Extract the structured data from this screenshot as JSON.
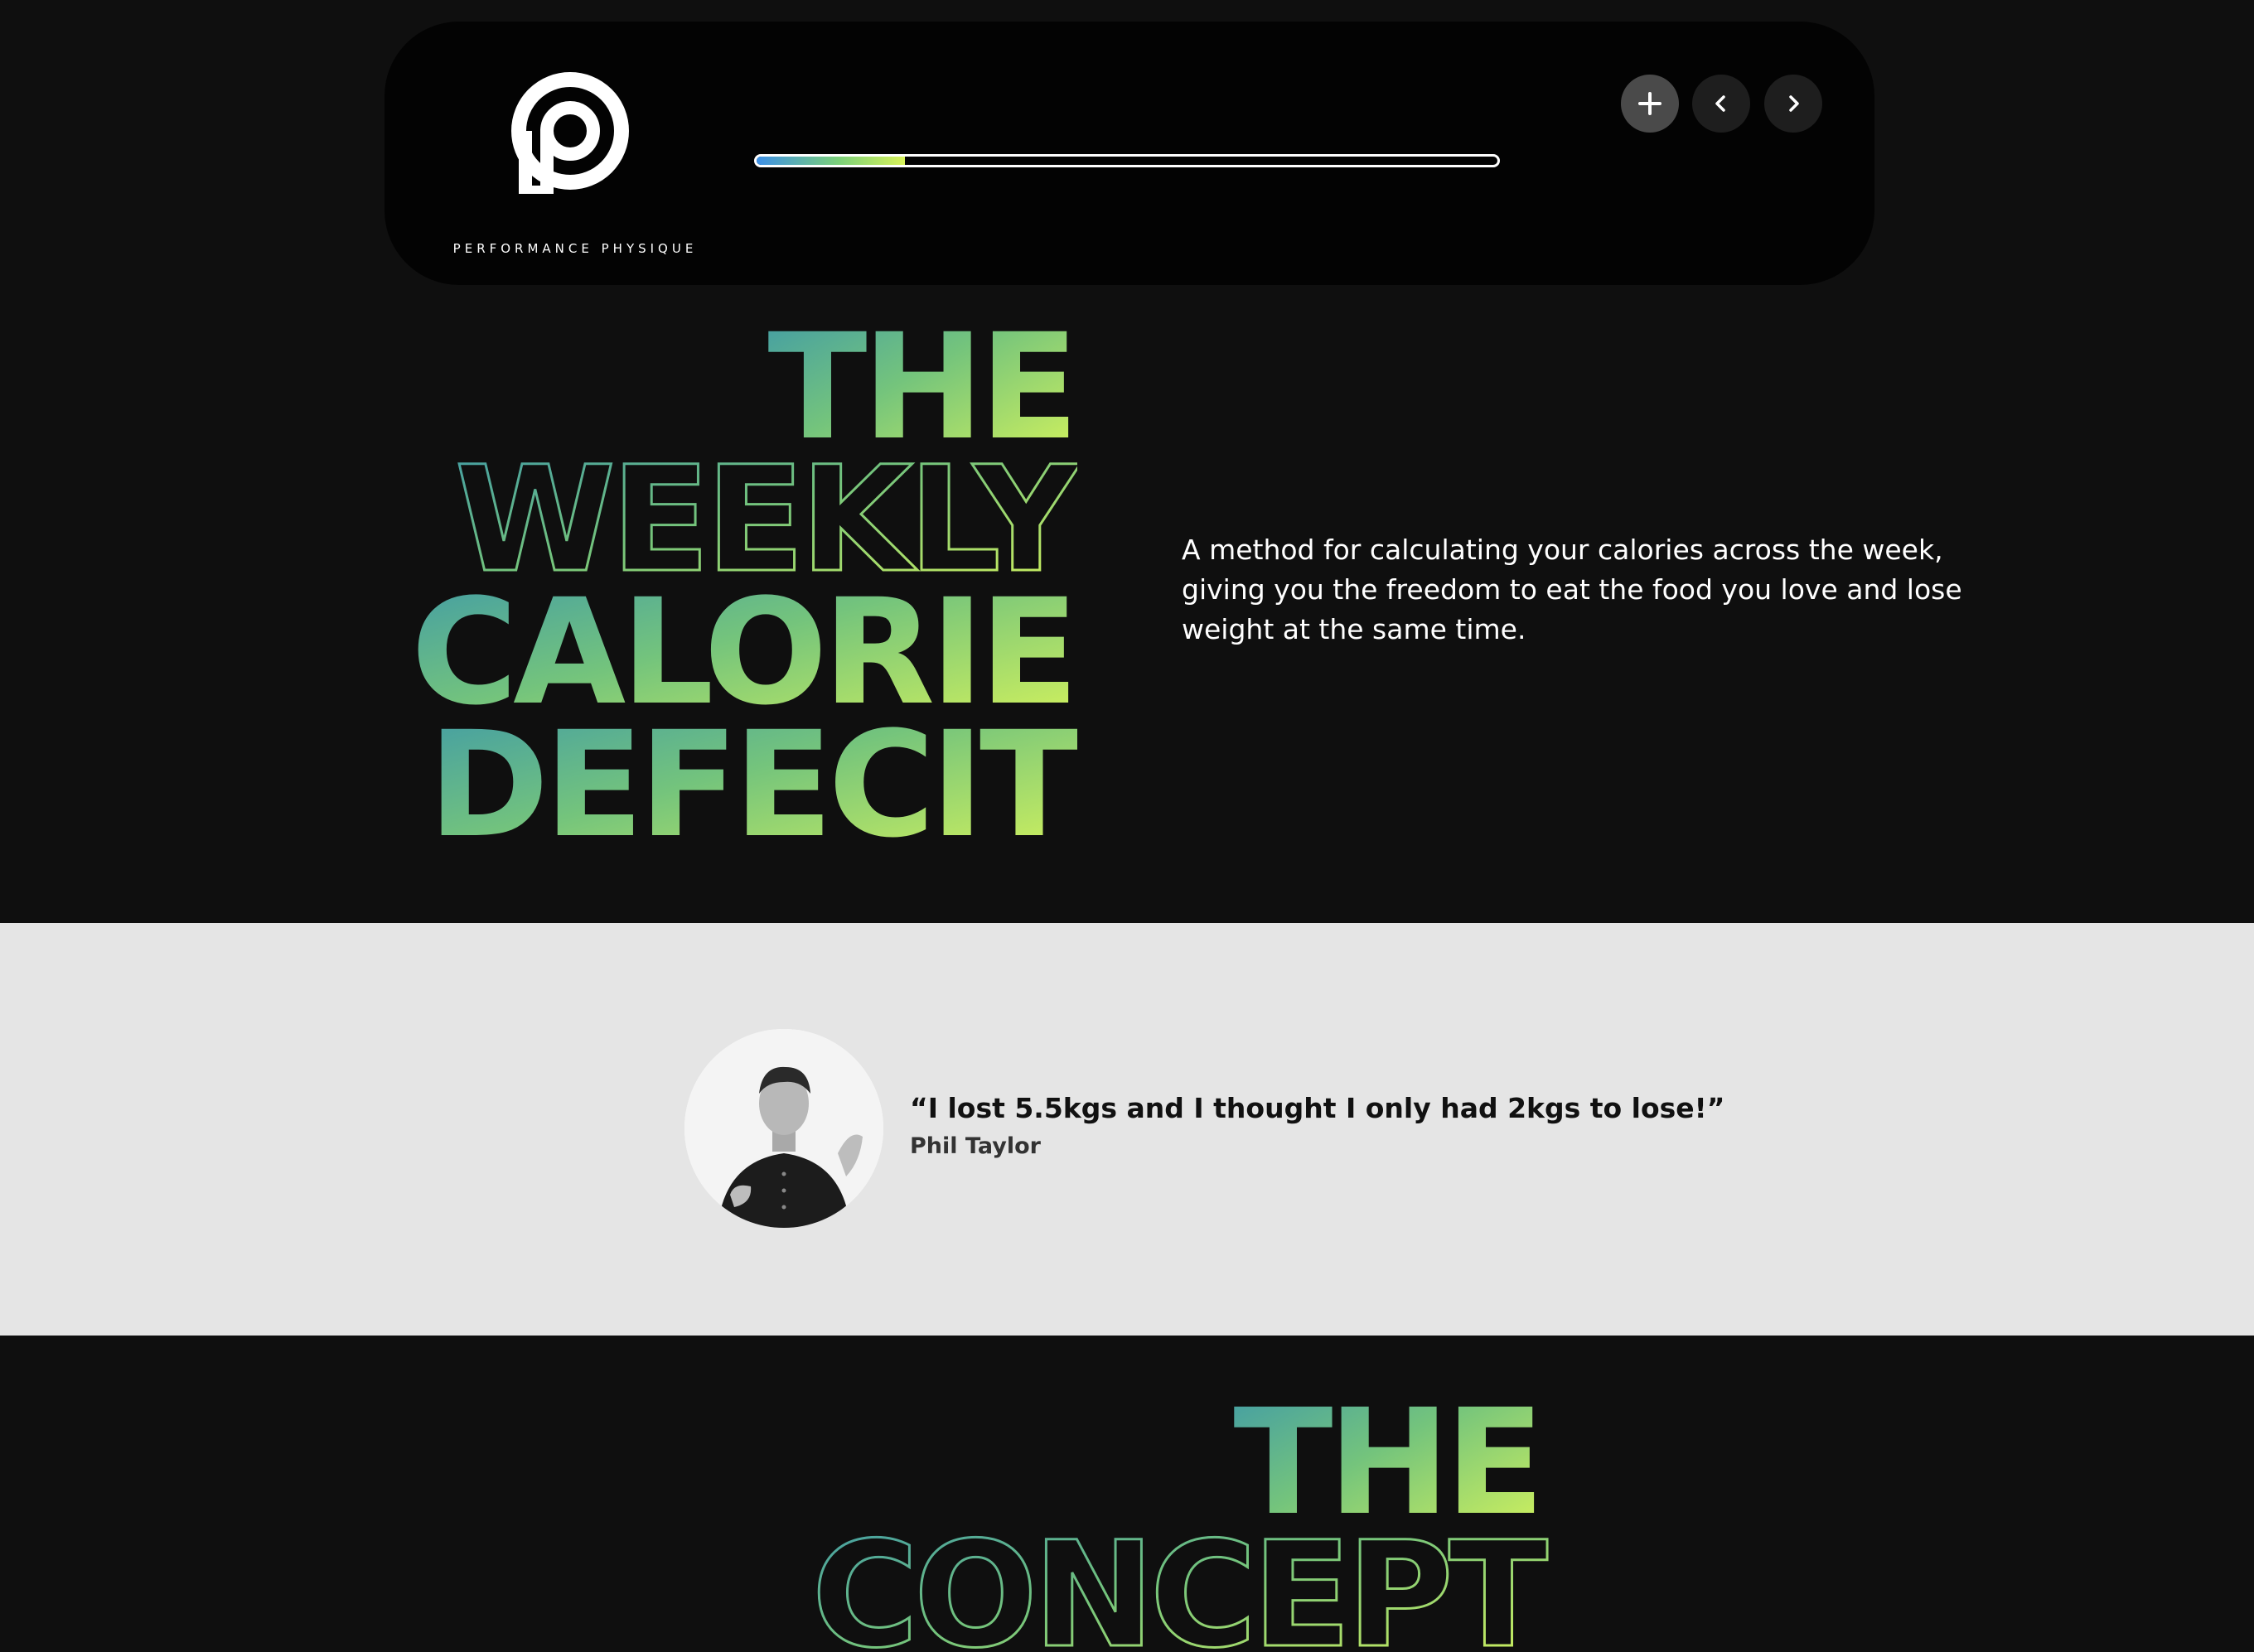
{
  "brand": {
    "name": "PERFORMANCE PHYSIQUE",
    "colors": {
      "accent_start": "#3d8fe6",
      "accent_mid": "#5fb39b",
      "accent_end": "#d8f25a",
      "dark_bg": "#0f0f0f",
      "light_bg": "#e5e5e5"
    }
  },
  "header": {
    "progress_fraction": 0.2,
    "controls": [
      {
        "icon": "plus-icon"
      },
      {
        "icon": "chevron-left-icon"
      },
      {
        "icon": "chevron-right-icon"
      }
    ]
  },
  "hero": {
    "title_lines": [
      "THE",
      "WEEKLY",
      "CALORIE",
      "DEFECIT"
    ],
    "description": "A method for calculating your calories across the week, giving you the freedom to eat the food you love and lose weight at the same time."
  },
  "testimonial": {
    "quote": "“I lost 5.5kgs and I thought I only had 2kgs to lose!”",
    "author": "Phil Taylor",
    "avatar_icon": "person-photo"
  },
  "concept": {
    "title_lines": [
      "THE",
      "CONCEPT"
    ]
  }
}
